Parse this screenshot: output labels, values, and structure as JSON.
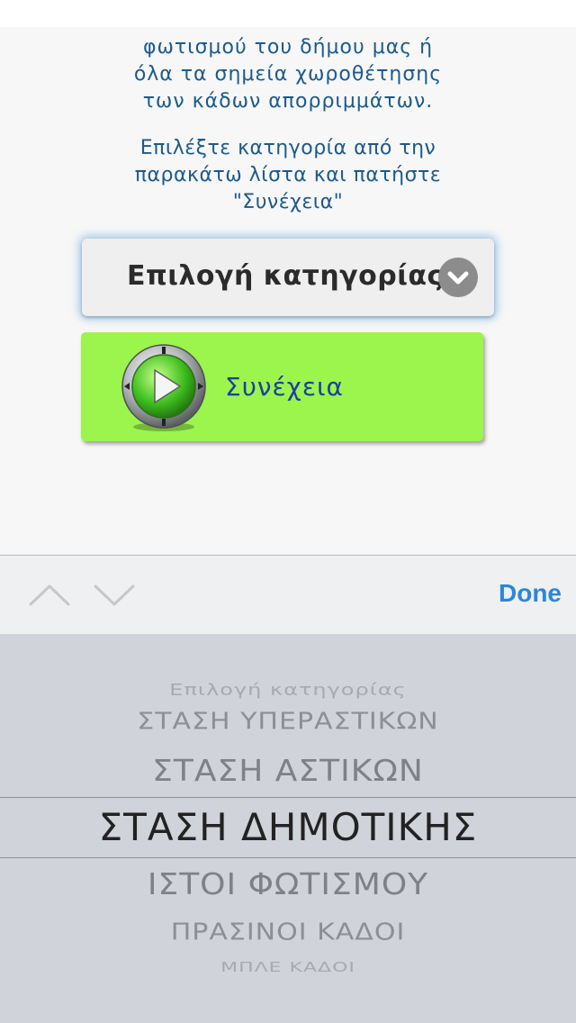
{
  "content": {
    "intro_partial_top": "φωτισμού του δήμου μας ή",
    "intro_lines": [
      "φωτισμού του δήμου μας ή",
      "όλα τα σημεία χωροθέτησης",
      "των κάδων απορριμμάτων."
    ],
    "instructions": [
      "Επιλέξτε κατηγορία από την",
      "παρακάτω λίστα και πατήστε",
      "\"Συνέχεια\""
    ],
    "select_label": "Επιλογή κατηγορίας",
    "continue_label": "Συνέχεια"
  },
  "toolbar": {
    "prev_icon": "chevron-up-icon",
    "next_icon": "chevron-down-icon",
    "done_label": "Done"
  },
  "picker": {
    "items": [
      "Επιλογή κατηγορίας",
      "ΣΤΑΣΗ ΥΠΕΡΑΣΤΙΚΩΝ",
      "ΣΤΑΣΗ ΑΣΤΙΚΩΝ",
      "ΣΤΑΣΗ ΔΗΜΟΤΙΚΗΣ",
      "ΙΣΤΟΙ ΦΩΤΙΣΜΟΥ",
      "ΠΡΑΣΙΝΟΙ ΚΑΔΟΙ",
      "ΜΠΛΕ ΚΑΔΟΙ"
    ],
    "selected": "ΣΤΑΣΗ ΔΗΜΟΤΙΚΗΣ"
  },
  "colors": {
    "text_blue": "#1d5a8a",
    "button_green": "#9bf54c",
    "done_blue": "#2c86d8",
    "picker_bg": "#d0d3d9"
  }
}
